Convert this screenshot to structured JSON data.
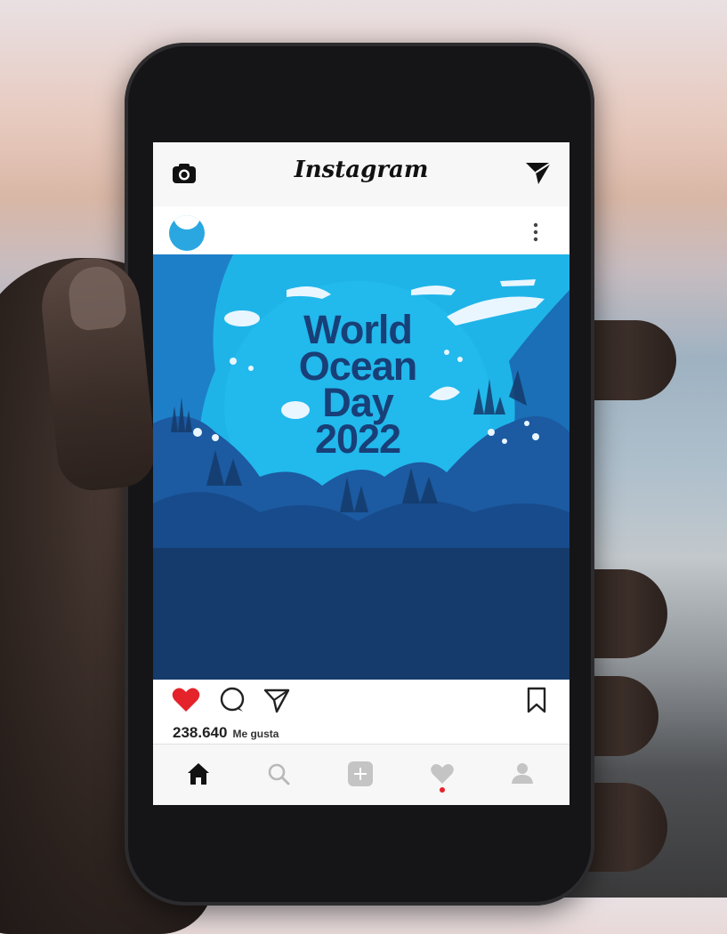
{
  "app": {
    "title": "Instagram"
  },
  "post": {
    "image_text": {
      "line1": "World",
      "line2": "Ocean",
      "line3": "Day",
      "line4": "2022"
    },
    "likes_count": "238.640",
    "likes_label": "Me gusta",
    "liked": true
  },
  "icons": {
    "camera": "camera-icon",
    "direct": "send-icon",
    "more": "more-vertical-icon",
    "like": "heart-icon",
    "comment": "comment-icon",
    "share": "send-icon",
    "save": "bookmark-icon",
    "home": "home-icon",
    "search": "search-icon",
    "add": "add-icon",
    "activity": "heart-icon",
    "profile": "profile-icon"
  },
  "colors": {
    "like_red": "#e4232b",
    "ocean_light": "#1fb4e8",
    "ocean_mid": "#1e7fc9",
    "ocean_dark": "#143b6b",
    "title_blue": "#183f77",
    "notification_dot": "#e4232b"
  }
}
